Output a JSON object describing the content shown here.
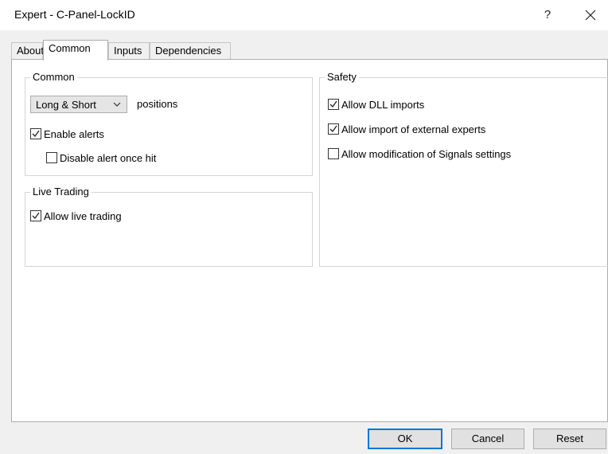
{
  "window": {
    "title": "Expert - C-Panel-LockID",
    "help_glyph": "?",
    "close_icon": "close-icon"
  },
  "tabs": [
    {
      "label": "About",
      "active": false
    },
    {
      "label": "Common",
      "active": true
    },
    {
      "label": "Inputs",
      "active": false
    },
    {
      "label": "Dependencies",
      "active": false
    }
  ],
  "common_group": {
    "legend": "Common",
    "positions_select": {
      "value": "Long & Short"
    },
    "positions_label": "positions",
    "enable_alerts": {
      "label": "Enable alerts",
      "checked": true
    },
    "disable_alert_once_hit": {
      "label": "Disable alert once hit",
      "checked": false
    }
  },
  "live_trading_group": {
    "legend": "Live Trading",
    "allow_live_trading": {
      "label": "Allow live trading",
      "checked": true
    }
  },
  "safety_group": {
    "legend": "Safety",
    "allow_dll_imports": {
      "label": "Allow DLL imports",
      "checked": true
    },
    "allow_import_external": {
      "label": "Allow import of external experts",
      "checked": true
    },
    "allow_signals_modification": {
      "label": "Allow modification of Signals settings",
      "checked": false
    }
  },
  "buttons": {
    "ok": "OK",
    "cancel": "Cancel",
    "reset": "Reset"
  },
  "colors": {
    "dialog_bg": "#f0f0f0",
    "panel_bg": "#ffffff",
    "default_button_border": "#0078d7",
    "button_bg": "#e1e1e1"
  }
}
